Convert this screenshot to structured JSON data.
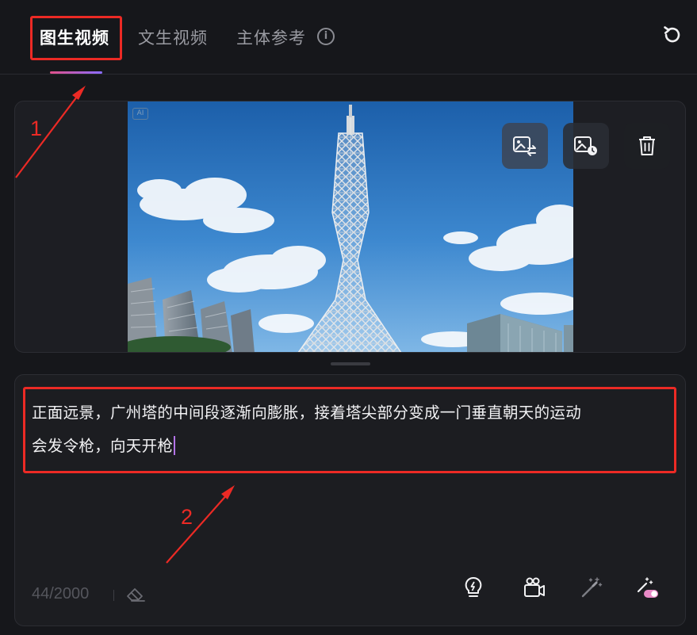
{
  "tabs": [
    {
      "label": "图生视频",
      "active": true
    },
    {
      "label": "文生视频",
      "active": false
    },
    {
      "label": "主体参考",
      "active": false
    }
  ],
  "tab_info_glyph": "i",
  "icons": {
    "refresh": "refresh-icon",
    "image_tools": [
      "image-replace-icon",
      "image-history-icon",
      "trash-icon"
    ],
    "bottom_toolbar": [
      "lightbulb-icon",
      "camera-icon",
      "magic-wand-icon",
      "magic-toggle-icon"
    ],
    "eraser": "eraser-icon"
  },
  "image": {
    "ai_badge": "AI",
    "subject": "Canton Tower against blue sky with clouds"
  },
  "prompt": {
    "line1": "正面远景，广州塔的中间段逐渐向膨胀，接着塔尖部分变成一门垂直朝天的运动",
    "line2": "会发令枪，向天开枪"
  },
  "char_count": "44/2000",
  "annotations": {
    "label_1": "1",
    "label_2": "2",
    "color": "#ec2a25"
  },
  "colors": {
    "background": "#16171b",
    "accent_gradient": [
      "#e0508a",
      "#8a6cff"
    ],
    "caret": "#b374e8"
  }
}
